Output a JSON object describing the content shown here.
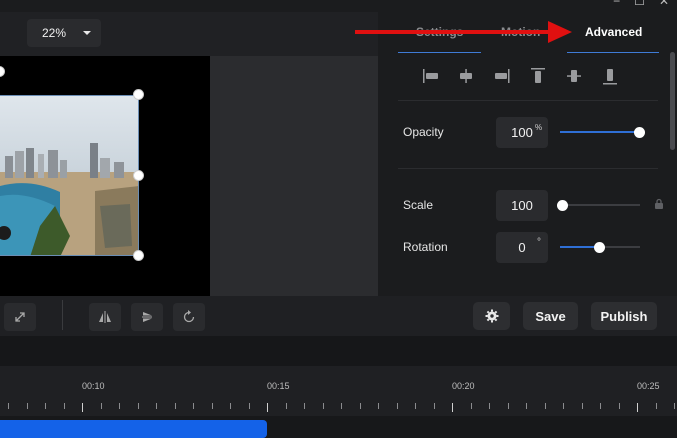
{
  "window": {
    "controls": [
      "−",
      "☐",
      "✕"
    ]
  },
  "preview": {
    "zoom": "22%"
  },
  "tabs": [
    {
      "label": "Settings",
      "active": false
    },
    {
      "label": "Motion",
      "active": false
    },
    {
      "label": "Advanced",
      "active": true
    }
  ],
  "align_icons": [
    "align-left-icon",
    "align-center-horizontal-icon",
    "align-right-icon",
    "align-top-icon",
    "align-middle-vertical-icon",
    "align-bottom-icon"
  ],
  "properties": {
    "opacity": {
      "label": "Opacity",
      "value": "100",
      "unit": "%",
      "fraction": 1.0
    },
    "scale": {
      "label": "Scale",
      "value": "100",
      "fraction": 0.0
    },
    "rotation": {
      "label": "Rotation",
      "value": "0",
      "unit": "°",
      "fraction": 0.5
    }
  },
  "toolbar": {
    "save_label": "Save",
    "publish_label": "Publish"
  },
  "timeline": {
    "tick_labels": [
      "00:10",
      "00:15",
      "00:20",
      "00:25"
    ]
  },
  "colors": {
    "accent": "#2f6fd6",
    "clip": "#1462e8",
    "annotation": "#e01010"
  }
}
